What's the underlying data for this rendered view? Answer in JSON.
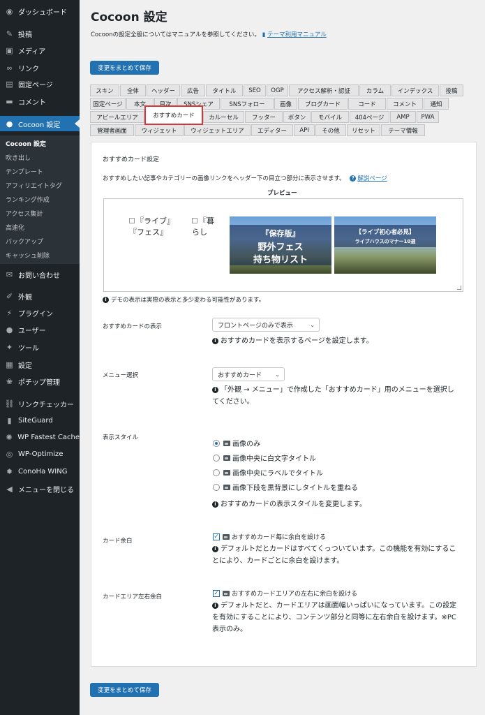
{
  "sidebar": {
    "items": [
      {
        "label": "ダッシュボード",
        "icon": "dashboard-icon",
        "glyph": "◉"
      },
      {
        "label": "投稿",
        "icon": "pin-icon",
        "glyph": "✎"
      },
      {
        "label": "メディア",
        "icon": "media-icon",
        "glyph": "▣"
      },
      {
        "label": "リンク",
        "icon": "link-icon",
        "glyph": "∞"
      },
      {
        "label": "固定ページ",
        "icon": "page-icon",
        "glyph": "▤"
      },
      {
        "label": "コメント",
        "icon": "comment-icon",
        "glyph": "▬"
      },
      {
        "label": "Cocoon 設定",
        "icon": "cocoon-icon",
        "glyph": "●"
      },
      {
        "label": "お問い合わせ",
        "icon": "mail-icon",
        "glyph": "✉"
      },
      {
        "label": "外観",
        "icon": "appearance-icon",
        "glyph": "✐"
      },
      {
        "label": "プラグイン",
        "icon": "plugin-icon",
        "glyph": "⚡"
      },
      {
        "label": "ユーザー",
        "icon": "user-icon",
        "glyph": "●"
      },
      {
        "label": "ツール",
        "icon": "tool-icon",
        "glyph": "✦"
      },
      {
        "label": "設定",
        "icon": "settings-icon",
        "glyph": "▦"
      },
      {
        "label": "ポチップ管理",
        "icon": "paw-icon",
        "glyph": "❀"
      },
      {
        "label": "リンクチェッカー",
        "icon": "link-checker-icon",
        "glyph": "⛓"
      },
      {
        "label": "SiteGuard",
        "icon": "siteguard-icon",
        "glyph": "▮"
      },
      {
        "label": "WP Fastest Cache",
        "icon": "cache-icon",
        "glyph": "✺"
      },
      {
        "label": "WP-Optimize",
        "icon": "optimize-icon",
        "glyph": "◎"
      },
      {
        "label": "ConoHa WING",
        "icon": "gear-icon",
        "glyph": "✹"
      },
      {
        "label": "メニューを閉じる",
        "icon": "collapse-icon",
        "glyph": "◀"
      }
    ],
    "submenu": [
      "Cocoon 設定",
      "吹き出し",
      "テンプレート",
      "アフィリエイトタグ",
      "ランキング作成",
      "アクセス集計",
      "高速化",
      "バックアップ",
      "キャッシュ削除"
    ]
  },
  "page": {
    "title": "Cocoon 設定",
    "intro": "Cocoonの設定全般についてはマニュアルを参照してください。",
    "manual_link": "テーマ利用マニュアル",
    "save_button": "変更をまとめて保存"
  },
  "tabs": {
    "row1": [
      "スキン",
      "全体",
      "ヘッダー",
      "広告",
      "タイトル",
      "SEO",
      "OGP",
      "アクセス解析・認証",
      "カラム",
      "インデックス",
      "投稿"
    ],
    "row2": [
      "固定ページ",
      "本文",
      "目次",
      "SNSシェア",
      "SNSフォロー",
      "画像",
      "ブログカード",
      "コード",
      "コメント",
      "通知"
    ],
    "row3": [
      "アピールエリア",
      "おすすめカード",
      "カルーセル",
      "フッター",
      "ボタン",
      "モバイル",
      "404ページ",
      "AMP",
      "PWA"
    ],
    "row4": [
      "管理者画面",
      "ウィジェット",
      "ウィジェットエリア",
      "エディター",
      "API",
      "その他",
      "リセット",
      "テーマ情報"
    ],
    "active": "おすすめカード"
  },
  "panel": {
    "heading": "おすすめカード設定",
    "description": "おすすめしたい記事やカテゴリーの画像リンクをヘッダー下の目立つ部分に表示させます。",
    "help_link": "解説ページ",
    "preview_label": "プレビュー",
    "preview": {
      "broken1_line1": "『ライブ』",
      "broken1_line2": "『フェス』",
      "broken2_line1": "『暮",
      "broken2_line2": "らし",
      "card1": {
        "line1": "『保存版』",
        "line2": "野外フェス",
        "line3": "持ち物リスト"
      },
      "card2": {
        "line1": "【ライブ初心者必見】",
        "line2": "ライブハウスのマナー10選"
      }
    },
    "demo_note": "デモの表示は実際の表示と多少変わる可能性があります。",
    "display": {
      "label": "おすすめカードの表示",
      "value": "フロントページのみで表示",
      "note": "おすすめカードを表示するページを設定します。"
    },
    "menu": {
      "label": "メニュー選択",
      "value": "おすすめカード",
      "note": "「外観 → メニュー」で作成した「おすすめカード」用のメニューを選択してください。"
    },
    "style": {
      "label": "表示スタイル",
      "options": [
        "画像のみ",
        "画像中央に白文字タイトル",
        "画像中央にラベルでタイトル",
        "画像下段を黒背景にしタイトルを重ねる"
      ],
      "selected": 0,
      "note": "おすすめカードの表示スタイルを変更します。"
    },
    "margin": {
      "label": "カード余白",
      "checkbox": "おすすめカード毎に余白を設ける",
      "checked": true,
      "note": "デフォルトだとカードはすべてくっついています。この機能を有効にすることにより、カードごとに余白を設けます。"
    },
    "area_margin": {
      "label": "カードエリア左右余白",
      "checkbox": "おすすめカードエリアの左右に余白を設ける",
      "checked": true,
      "note": "デフォルトだと、カードエリアは画面幅いっぱいになっています。この設定を有効にすることにより、コンテンツ部分と同等に左右余白を設けます。※PC表示のみ。"
    }
  },
  "colors": {
    "accent": "#2271b1",
    "sidebar_bg": "#1d2327",
    "highlight": "#d63638"
  }
}
